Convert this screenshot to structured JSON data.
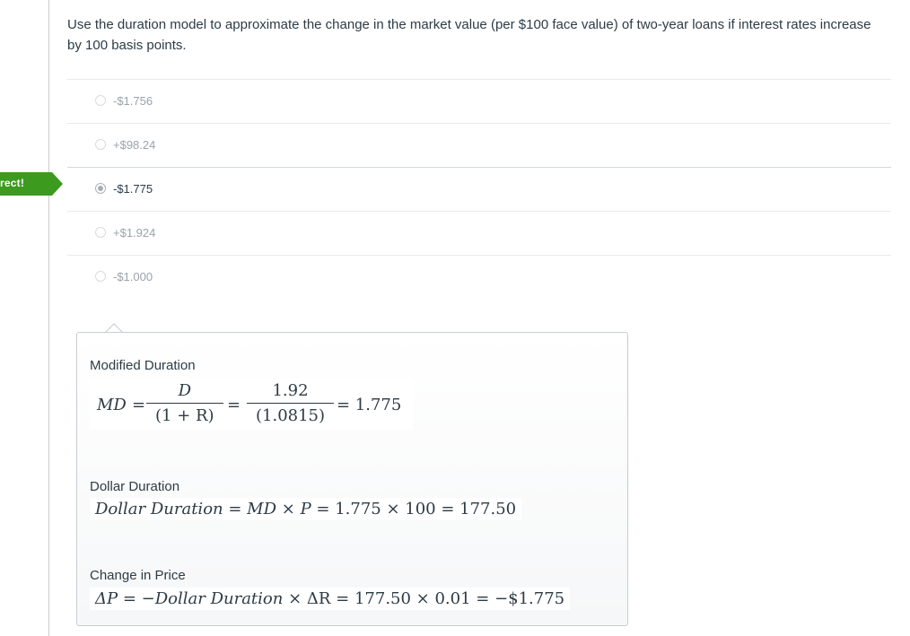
{
  "status": {
    "label": "rect!"
  },
  "question": {
    "text": "Use the duration model to approximate the change in the market value (per $100 face value) of two-year loans if interest rates increase by 100 basis points."
  },
  "answers": [
    {
      "label": "-$1.756",
      "selected": false
    },
    {
      "label": "+$98.24",
      "selected": false
    },
    {
      "label": "-$1.775",
      "selected": true
    },
    {
      "label": "+$1.924",
      "selected": false
    },
    {
      "label": "-$1.000",
      "selected": false
    }
  ],
  "feedback": {
    "modified_duration": {
      "title": "Modified Duration",
      "md_label": "MD",
      "eq": "=",
      "num1": "D",
      "den1": "(1 + R)",
      "num2": "1.92",
      "den2": "(1.0815)",
      "result": "= 1.775"
    },
    "dollar_duration": {
      "title": "Dollar Duration",
      "formula_italic": "Dollar Duration",
      "formula_rest": " = ",
      "md": "MD",
      "rest": " × ",
      "p": "P",
      "tail": " = 1.775 × 100 = 177.50"
    },
    "change_in_price": {
      "title": "Change in Price",
      "delta_p": "ΔP",
      "eq": " = −",
      "dd": "Dollar Duration",
      "tail": " × ΔR = 177.50 × 0.01 = −$1.775"
    }
  },
  "colors": {
    "correct_green": "#3c9a1e",
    "border": "#c7cdd1",
    "text": "#2d3b45"
  }
}
